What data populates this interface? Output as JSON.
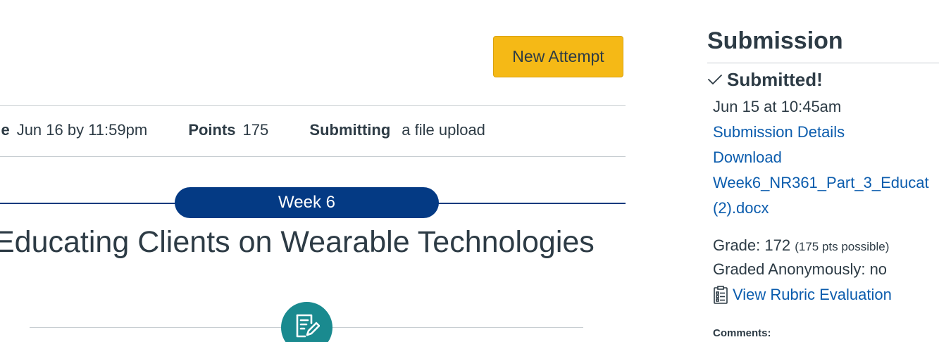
{
  "actions": {
    "new_attempt_label": "New Attempt"
  },
  "details": {
    "due_label": "ue",
    "due_value": "Jun 16 by 11:59pm",
    "points_label": "Points",
    "points_value": "175",
    "submitting_label": "Submitting",
    "submitting_value": "a file upload"
  },
  "banner": {
    "week_label": "Week 6"
  },
  "assignment": {
    "title": "Educating Clients on Wearable Technologies",
    "icon": "assignment-edit-icon"
  },
  "sidebar": {
    "title": "Submission",
    "status": "Submitted!",
    "status_icon": "checkmark-icon",
    "submitted_at": "Jun 15 at 10:45am",
    "details_link": "Submission Details",
    "download_label": "Download",
    "file_name_line1": "Week6_NR361_Part_3_Educat",
    "file_name_line2": "(2).docx",
    "grade_label": "Grade: 172",
    "grade_possible": "(175 pts possible)",
    "anonymous": "Graded Anonymously: no",
    "rubric_link": "View Rubric Evaluation",
    "rubric_icon": "rubric-icon",
    "comments_label": "Comments:"
  },
  "colors": {
    "primary_button": "#f5b916",
    "week_banner": "#043a84",
    "link": "#0b5cad",
    "icon_circle": "#1a8a8f",
    "text": "#2d3b45"
  }
}
